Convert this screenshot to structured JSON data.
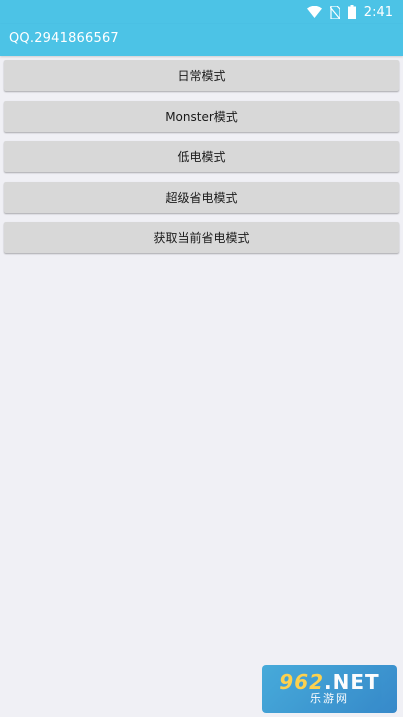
{
  "status_bar": {
    "time": "2:41",
    "icons": [
      "wifi-icon",
      "no-sim-icon",
      "battery-icon"
    ]
  },
  "toolbar": {
    "title": "QQ.2941866567"
  },
  "buttons": [
    {
      "label": "日常模式"
    },
    {
      "label": "Monster模式"
    },
    {
      "label": "低电模式"
    },
    {
      "label": "超级省电模式"
    },
    {
      "label": "获取当前省电模式"
    }
  ],
  "watermark": {
    "top_num": "962",
    "top_suffix": ".NET",
    "bottom": "乐游网"
  },
  "colors": {
    "header": "#4cc3e6",
    "background": "#f0f0f5",
    "button": "#d8d8d8"
  }
}
